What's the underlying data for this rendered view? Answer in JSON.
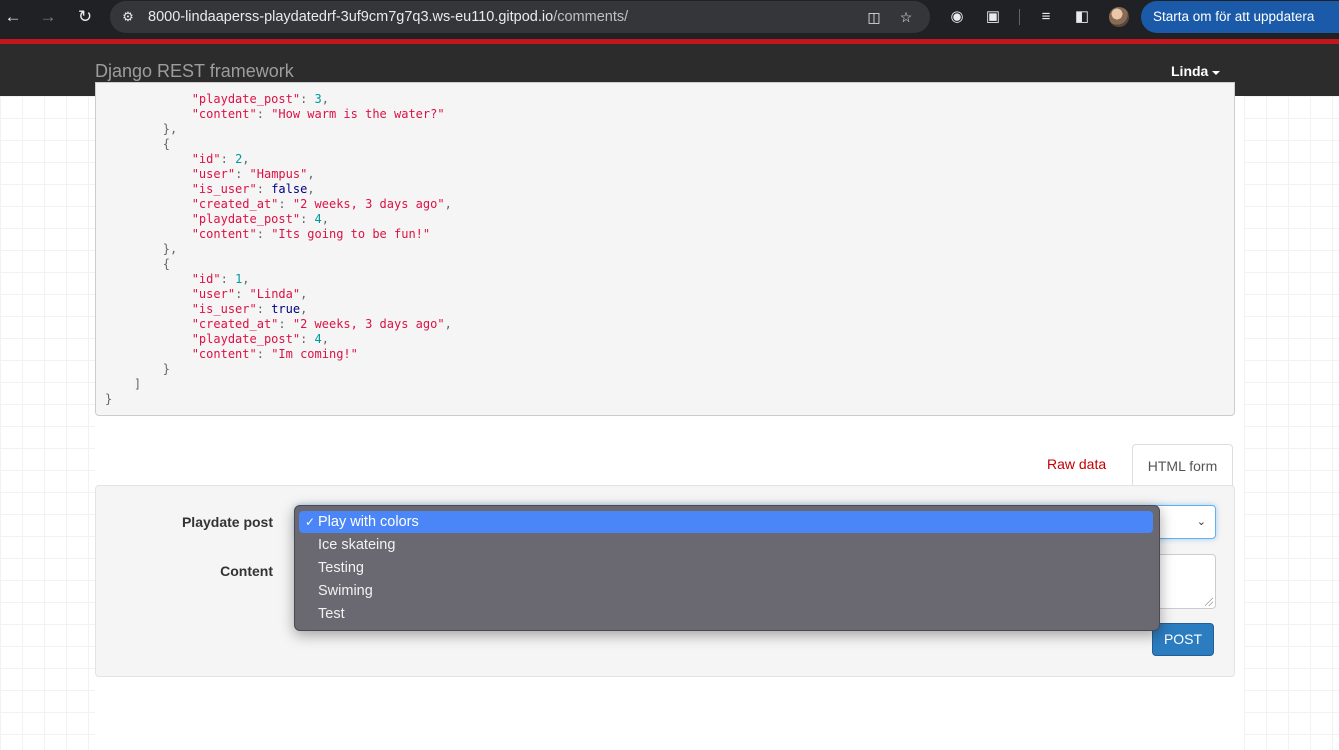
{
  "browser": {
    "url_host": "8000-lindaaperss-playdatedrf-3uf9cm7g7q3.ws-eu110.gitpod.io",
    "url_path": "/comments/",
    "update_button": "Starta om för att uppdatera"
  },
  "navbar": {
    "brand": "Django REST framework",
    "user": "Linda"
  },
  "response": {
    "lines": [
      {
        "indent": "            ",
        "key": "\"playdate_post\"",
        "val": "3",
        "type": "n",
        "comma": ","
      },
      {
        "indent": "            ",
        "key": "\"content\"",
        "val": "\"How warm is the water?\"",
        "type": "s",
        "comma": ""
      },
      {
        "indent": "        ",
        "punct": "},"
      },
      {
        "indent": "        ",
        "punct": "{"
      },
      {
        "indent": "            ",
        "key": "\"id\"",
        "val": "2",
        "type": "n",
        "comma": ","
      },
      {
        "indent": "            ",
        "key": "\"user\"",
        "val": "\"Hampus\"",
        "type": "s",
        "comma": ","
      },
      {
        "indent": "            ",
        "key": "\"is_user\"",
        "val": "false",
        "type": "b",
        "comma": ","
      },
      {
        "indent": "            ",
        "key": "\"created_at\"",
        "val": "\"2 weeks, 3 days ago\"",
        "type": "s",
        "comma": ","
      },
      {
        "indent": "            ",
        "key": "\"playdate_post\"",
        "val": "4",
        "type": "n",
        "comma": ","
      },
      {
        "indent": "            ",
        "key": "\"content\"",
        "val": "\"Its going to be fun!\"",
        "type": "s",
        "comma": ""
      },
      {
        "indent": "        ",
        "punct": "},"
      },
      {
        "indent": "        ",
        "punct": "{"
      },
      {
        "indent": "            ",
        "key": "\"id\"",
        "val": "1",
        "type": "n",
        "comma": ","
      },
      {
        "indent": "            ",
        "key": "\"user\"",
        "val": "\"Linda\"",
        "type": "s",
        "comma": ","
      },
      {
        "indent": "            ",
        "key": "\"is_user\"",
        "val": "true",
        "type": "b",
        "comma": ","
      },
      {
        "indent": "            ",
        "key": "\"created_at\"",
        "val": "\"2 weeks, 3 days ago\"",
        "type": "s",
        "comma": ","
      },
      {
        "indent": "            ",
        "key": "\"playdate_post\"",
        "val": "4",
        "type": "n",
        "comma": ","
      },
      {
        "indent": "            ",
        "key": "\"content\"",
        "val": "\"Im coming!\"",
        "type": "s",
        "comma": ""
      },
      {
        "indent": "        ",
        "punct": "}"
      },
      {
        "indent": "    ",
        "punct": "]"
      },
      {
        "indent": "",
        "punct": "}"
      }
    ]
  },
  "tabs": {
    "raw": "Raw data",
    "html": "HTML form"
  },
  "form": {
    "playdate_label": "Playdate post",
    "content_label": "Content",
    "post_button": "POST",
    "options": [
      "Play with colors",
      "Ice skateing",
      "Testing",
      "Swiming",
      "Test"
    ],
    "selected_index": 0
  }
}
